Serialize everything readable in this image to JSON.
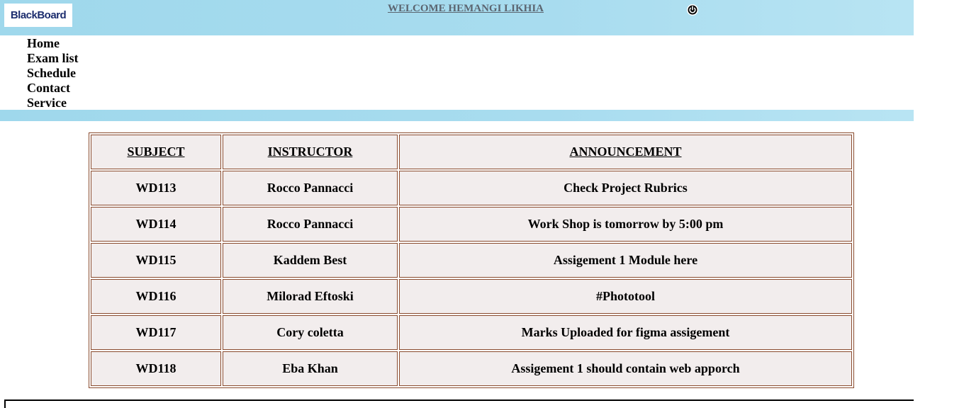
{
  "header": {
    "logo_text": "BlackBoard",
    "welcome": "WELCOME HEMANGI LIKHIA",
    "power_icon": "power-icon"
  },
  "nav": {
    "items": [
      {
        "label": "Home"
      },
      {
        "label": "Exam list"
      },
      {
        "label": "Schedule"
      },
      {
        "label": "Contact"
      },
      {
        "label": "Service"
      }
    ]
  },
  "table": {
    "headers": {
      "subject": "SUBJECT",
      "instructor": "INSTRUCTOR",
      "announcement": "ANNOUNCEMENT"
    },
    "rows": [
      {
        "subject": "WD113",
        "instructor": "Rocco Pannacci",
        "announcement": "Check Project Rubrics"
      },
      {
        "subject": "WD114",
        "instructor": "Rocco Pannacci",
        "announcement": "Work Shop is tomorrow by 5:00 pm"
      },
      {
        "subject": "WD115",
        "instructor": "Kaddem Best",
        "announcement": "Assigement 1 Module here"
      },
      {
        "subject": "WD116",
        "instructor": "Milorad Eftoski",
        "announcement": "#Phototool"
      },
      {
        "subject": "WD117",
        "instructor": "Cory coletta",
        "announcement": "Marks Uploaded for figma assigement"
      },
      {
        "subject": "WD118",
        "instructor": "Eba Khan",
        "announcement": "Assigement 1 should contain web apporch"
      }
    ]
  },
  "colors": {
    "header_bg": "#a8dcef",
    "cell_bg": "#f2eded",
    "cell_border": "#8a4b2e"
  }
}
